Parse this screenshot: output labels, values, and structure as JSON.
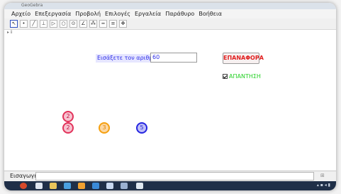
{
  "window": {
    "title": "GeoGebra"
  },
  "menu": [
    "Αρχείο",
    "Επεξεργασία",
    "Προβολή",
    "Επιλογές",
    "Εργαλεία",
    "Παράθυρο",
    "Βοήθεια"
  ],
  "toolbar": {
    "tools": [
      "move-tool",
      "point-tool",
      "line-tool",
      "perpendicular-tool",
      "polygon-tool",
      "circle-tool",
      "conic-tool",
      "angle-tool",
      "slider-tool",
      "zoom-tool",
      "move-view-tool"
    ]
  },
  "canvas": {
    "prompt_label": "Εισάξετε τον αριθμό",
    "number_input": "60",
    "reset_button": "ΕΠΑΝΑΦΟΡΑ",
    "answer_label": "ΑΠΑΝΤΗΣΗ",
    "answer_checked": true,
    "circles": [
      {
        "label": "2",
        "color": "#e2335b"
      },
      {
        "label": "2",
        "color": "#e2335b"
      },
      {
        "label": "3",
        "color": "#f5a010"
      },
      {
        "label": "5",
        "color": "#2525e0"
      }
    ]
  },
  "input_bar": {
    "label": "Εισαγωγή:",
    "value": ""
  },
  "colors": {
    "prompt": "#2e2ee8",
    "reset": "#e02020",
    "answer": "#22d022",
    "taskbar": "#1f2f48"
  }
}
